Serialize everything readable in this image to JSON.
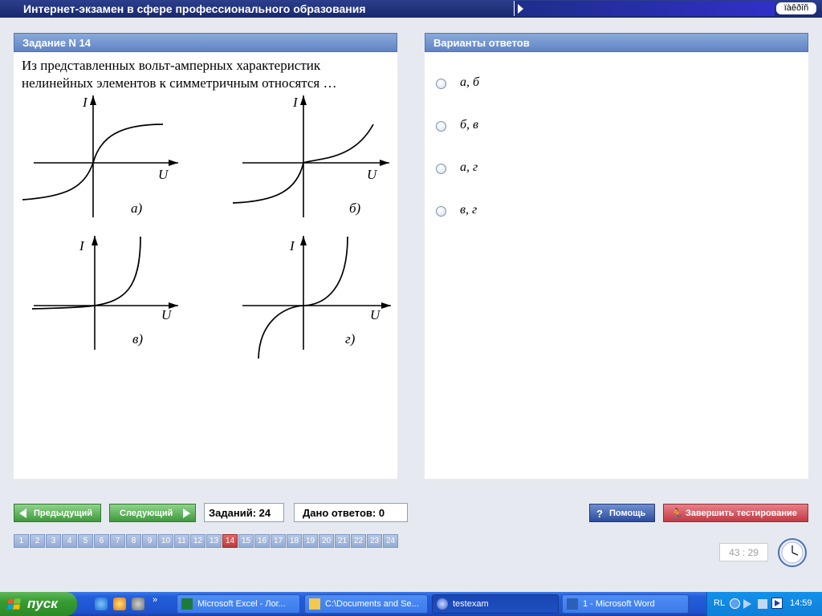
{
  "window": {
    "title": "Интернет-экзамен в сфере профессионального образования",
    "lang_indicator": "ïàêðîñ"
  },
  "task": {
    "header": "Задание N 14",
    "question": "Из представленных вольт-амперных характеристик нелинейных элементов к симметричным относятся …",
    "graphs": [
      {
        "caption": "а)",
        "y_axis": "I",
        "x_axis": "U"
      },
      {
        "caption": "б)",
        "y_axis": "I",
        "x_axis": "U"
      },
      {
        "caption": "в)",
        "y_axis": "I",
        "x_axis": "U"
      },
      {
        "caption": "г)",
        "y_axis": "I",
        "x_axis": "U"
      }
    ]
  },
  "answers": {
    "header": "Варианты ответов",
    "options": [
      "а, б",
      "б, в",
      "а, г",
      "в, г"
    ]
  },
  "nav": {
    "prev_label": "Предыдущий",
    "next_label": "Следующий",
    "tasks_count": "Заданий: 24",
    "answers_given": "Дано ответов: 0",
    "help_label": "Помощь",
    "finish_label": "Завершить тестирование",
    "current_page": 14,
    "pages": [
      "1",
      "2",
      "3",
      "4",
      "5",
      "6",
      "7",
      "8",
      "9",
      "10",
      "11",
      "12",
      "13",
      "14",
      "15",
      "16",
      "17",
      "18",
      "19",
      "20",
      "21",
      "22",
      "23",
      "24"
    ],
    "timer": "43 : 29"
  },
  "taskbar": {
    "start_label": "пуск",
    "items": [
      {
        "label": "Microsoft Excel - Лог...",
        "icon": "excel-icon"
      },
      {
        "label": "C:\\Documents and Se...",
        "icon": "folder-icon"
      },
      {
        "label": "testexam",
        "icon": "testexam-icon"
      },
      {
        "label": "1 - Microsoft Word",
        "icon": "word-icon"
      }
    ],
    "tray_lang": "RL",
    "time": "14:59"
  },
  "colors": {
    "titlebar": "#19296e",
    "panel_header": "#6f92cc",
    "nav_green": "#3f9a3d",
    "help_blue": "#2c4c9c",
    "finish_red": "#c23a44",
    "page_active": "#b93a3a",
    "taskbar": "#245edb"
  }
}
